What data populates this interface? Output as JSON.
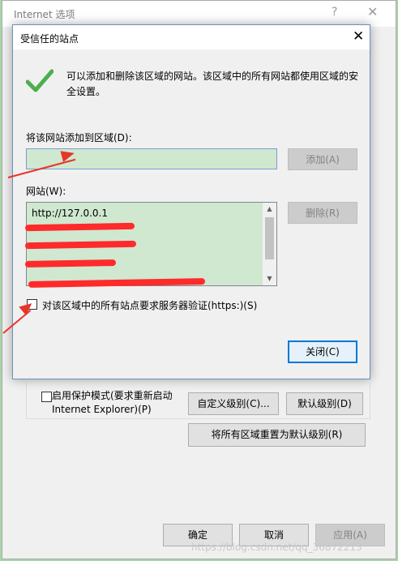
{
  "parent_window": {
    "title": "Internet 选项",
    "help_glyph": "?",
    "close_glyph": "✕",
    "protected_mode_line1": "启用保护模式(要求重新启动",
    "protected_mode_line2": "Internet Explorer)(P)",
    "custom_level_label": "自定义级别(C)...",
    "default_level_label": "默认级别(D)",
    "reset_all_label": "将所有区域重置为默认级别(R)",
    "ok_label": "确定",
    "cancel_label": "取消",
    "apply_label": "应用(A)"
  },
  "dialog": {
    "title": "受信任的站点",
    "close_glyph": "✕",
    "check_icon_color": "#4cae4c",
    "description": "可以添加和删除该区域的网站。该区域中的所有网站都使用区域的安全设置。",
    "add_site_label": "将该网站添加到区域(D):",
    "site_input_value": "",
    "add_button_label": "添加(A)",
    "websites_label": "网站(W):",
    "websites": [
      "http://127.0.0.1"
    ],
    "remove_button_label": "删除(R)",
    "https_checkbox_label": "对该区域中的所有站点要求服务器验证(https:)(S)",
    "https_checked": false,
    "close_button_label": "关闭(C)"
  },
  "watermark": "https://blog.csdn.net/qq_36872213",
  "annotation_color": "#e8342a",
  "redaction_color": "#ff2a2a"
}
